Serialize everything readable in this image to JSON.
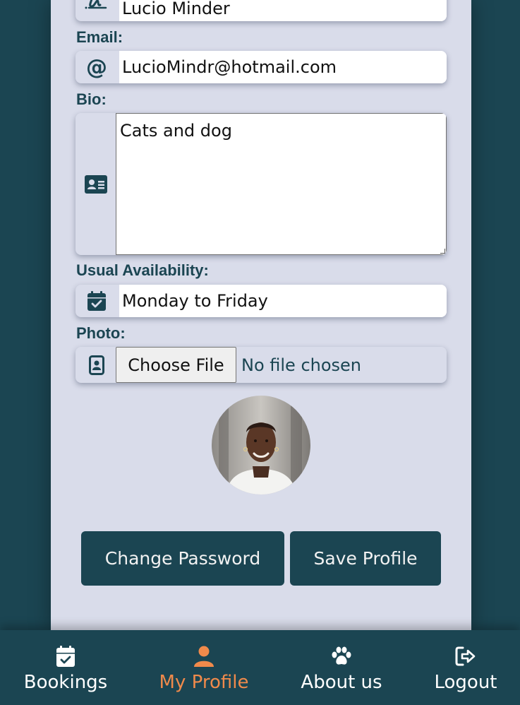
{
  "form": {
    "name_value": "Lucio Minder",
    "email_label": "Email:",
    "email_value": "LucioMindr@hotmail.com",
    "bio_label": "Bio:",
    "bio_value": "Cats and dog",
    "availability_label": "Usual Availability:",
    "availability_value": "Monday to Friday",
    "photo_label": "Photo:",
    "choose_file_label": "Choose File",
    "file_status": "No file chosen"
  },
  "actions": {
    "change_password_label": "Change Password",
    "save_profile_label": "Save Profile"
  },
  "nav": {
    "items": [
      {
        "label": "Bookings",
        "icon": "calendar-check-icon",
        "active": false
      },
      {
        "label": "My Profile",
        "icon": "user-icon",
        "active": true
      },
      {
        "label": "About us",
        "icon": "paw-icon",
        "active": false
      },
      {
        "label": "Logout",
        "icon": "logout-icon",
        "active": false
      }
    ]
  },
  "colors": {
    "brand_dark": "#1b4552",
    "panel": "#d9dcea",
    "accent": "#f08a4b"
  }
}
